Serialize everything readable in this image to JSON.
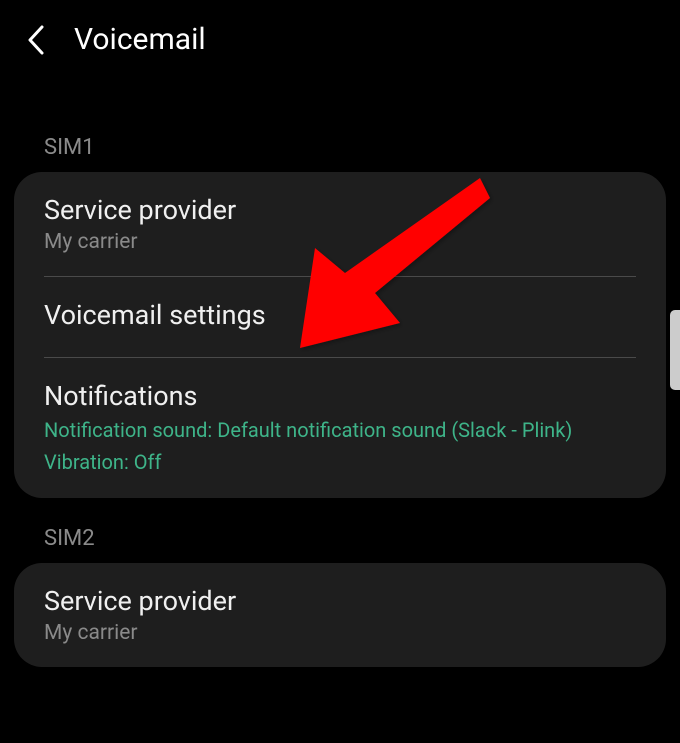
{
  "header": {
    "title": "Voicemail"
  },
  "sim1": {
    "label": "SIM1",
    "items": {
      "service_provider": {
        "title": "Service provider",
        "subtitle": "My carrier"
      },
      "voicemail_settings": {
        "title": "Voicemail settings"
      },
      "notifications": {
        "title": "Notifications",
        "sound_line": "Notification sound: Default notification sound (Slack - Plink)",
        "vibration_line": "Vibration: Off"
      }
    }
  },
  "sim2": {
    "label": "SIM2",
    "items": {
      "service_provider": {
        "title": "Service provider",
        "subtitle": "My carrier"
      }
    }
  }
}
